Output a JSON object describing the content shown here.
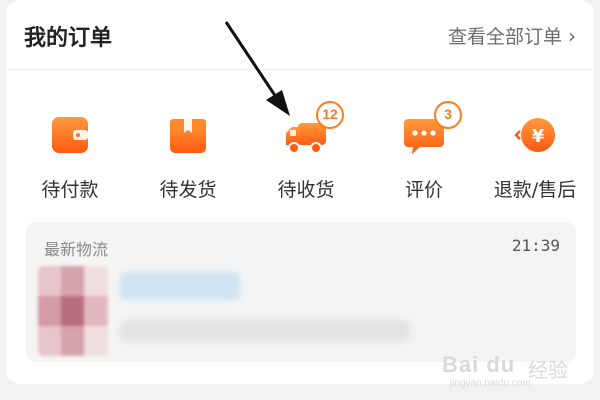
{
  "header": {
    "title": "我的订单",
    "view_all": "查看全部订单",
    "chevron": "›"
  },
  "status_items": [
    {
      "label": "待付款",
      "icon": "wallet-icon",
      "badge": ""
    },
    {
      "label": "待发货",
      "icon": "package-icon",
      "badge": ""
    },
    {
      "label": "待收货",
      "icon": "truck-icon",
      "badge": "12"
    },
    {
      "label": "评价",
      "icon": "comment-icon",
      "badge": "3"
    },
    {
      "label": "退款/售后",
      "icon": "refund-icon",
      "badge": ""
    }
  ],
  "logistics": {
    "title": "最新物流",
    "time": "21:39"
  },
  "watermark": {
    "brand": "Bai du",
    "cn": "经验",
    "url": "jingyan.baidu.com"
  },
  "colors": {
    "accent": "#ff7a1a",
    "text": "#333333",
    "muted": "#8a8a8a"
  }
}
